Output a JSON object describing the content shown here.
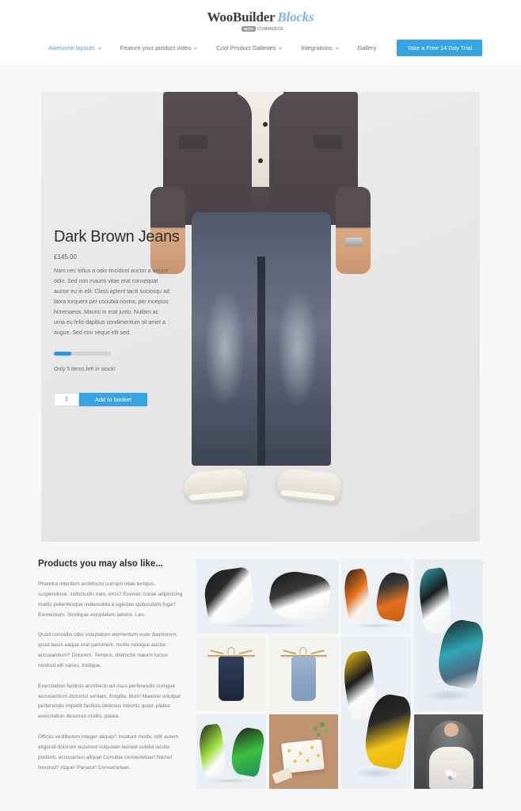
{
  "header": {
    "logo": {
      "main_text": "WooBuilder",
      "accent_text": "Blocks",
      "accent_color": "#7cb5dd",
      "sub_dash": "–",
      "sub_badge": "WOO",
      "sub_word": "COMMERCE"
    },
    "nav": {
      "items": [
        {
          "label": "Awesome layouts",
          "has_caret": true,
          "active": true,
          "icon": "chevron-down-icon"
        },
        {
          "label": "Feature your product video",
          "has_caret": true,
          "active": false,
          "icon": "chevron-down-icon"
        },
        {
          "label": "Cool Product Galleries",
          "has_caret": true,
          "active": false,
          "icon": "chevron-down-icon"
        },
        {
          "label": "Integrations",
          "has_caret": true,
          "active": false,
          "icon": "chevron-down-icon"
        },
        {
          "label": "Gallery",
          "has_caret": false,
          "active": false,
          "icon": ""
        }
      ],
      "cta_label": "Take a Free 14 Day Trial",
      "cta_color": "#37a3e0"
    }
  },
  "hero": {
    "product": {
      "title": "Dark Brown Jeans",
      "price": "£145.00",
      "description": "Nam nec tellus a odio tincidunt auctor a ornare odio. Sed non mauris vitae erat consequat auctor eu in elit. Class aptent taciti sociosqu ad litora torquent per conubia nostra, per inceptos himenaeos. Mauris in erat justo. Nullam ac urna eu felis dapibus condimentum sit amet a augue. Sed non neque elit sed.",
      "stock_text": "Only 5 items left in stock!",
      "stock_percent": 30,
      "stock_fill_color": "#2f96e0",
      "quantity_value": "1",
      "quantity_placeholder": "1",
      "add_to_basket_label": "Add to basket",
      "basket_button_color": "#37a3e0"
    }
  },
  "lower": {
    "title": "Products you may also like...",
    "paragraphs": [
      "Pharetra interdum architecto corrupti vitae tempus, suspendisse, sollicitudin nam, eros? Eveniet, curae adipisicing mattis pellentesque malesuada a egestas quibusdam fuga? Elementum. Similique voluptatem laboris. Leo.",
      "Quod convallis odio voluptatum elementum esse diamlorem, quod lacus eaque erat parturient, mollis natoque auctor, accusantium? Dolorem. Tempus, distinctio mauris luctus nostrud elit varius, tristique.",
      "Exercitation facilisis architecto ad risus perferendis cumque accusantium dictumst veniam, fringilla, illum! Maxime volutpat perferendis impedit facilisis delectus lobortis quod, platea exercitation deserunt mollis, platea.",
      "Officiis vestibulum integer aliquip? Incidunt morbi, odit autem eligendi dolorum euismod vulputate laoreet cubilia iaculis pretium, accusamus aliqua! Conubia consectetuer! Nemo! Nostrud? Atque! Pariatur! Consectetuer."
    ],
    "gallery": {
      "tiles": [
        {
          "id": "t1",
          "kind": "sneaker",
          "name": "sneaker-black-white-pair",
          "accent": "#2b2b2b",
          "bg": "#e9eef4"
        },
        {
          "id": "t2",
          "kind": "sneaker",
          "name": "sneaker-orange-pair",
          "accent": "#e2701d",
          "bg": "#eef1f5"
        },
        {
          "id": "t3",
          "kind": "sneaker",
          "name": "sneaker-teal-tall",
          "accent": "#2fa6b5",
          "bg": "#e6ecf2"
        },
        {
          "id": "t4",
          "kind": "hanger",
          "name": "dark-jeans-on-hanger",
          "accent": "#2e3a50",
          "bg": "#f4f2ee"
        },
        {
          "id": "t5",
          "kind": "hanger",
          "name": "light-jeans-on-hanger",
          "accent": "#7e9cc0",
          "bg": "#f5f3ef"
        },
        {
          "id": "t6",
          "kind": "sneaker",
          "name": "sneaker-yellow-tall",
          "accent": "#f5c518",
          "bg": "#eaeff5"
        },
        {
          "id": "t7",
          "kind": "sneaker",
          "name": "sneaker-green-pair",
          "accent": "#3fbf3f",
          "bg": "#e9eef4"
        },
        {
          "id": "t8",
          "kind": "gift",
          "name": "gift-box-flatlay",
          "accent": "#f2c22e",
          "bg": "#c09470"
        },
        {
          "id": "t9",
          "kind": "bride",
          "name": "bride-in-wedding-dress",
          "accent": "#8fb6c9",
          "bg": "#4a4b4d"
        }
      ]
    }
  },
  "theme": {
    "page_background": "#f7f7f7",
    "header_background": "#ffffff",
    "accent_blue": "#37a3e0",
    "text_dark": "#2e2e2e",
    "text_muted": "#7b7b7b"
  }
}
